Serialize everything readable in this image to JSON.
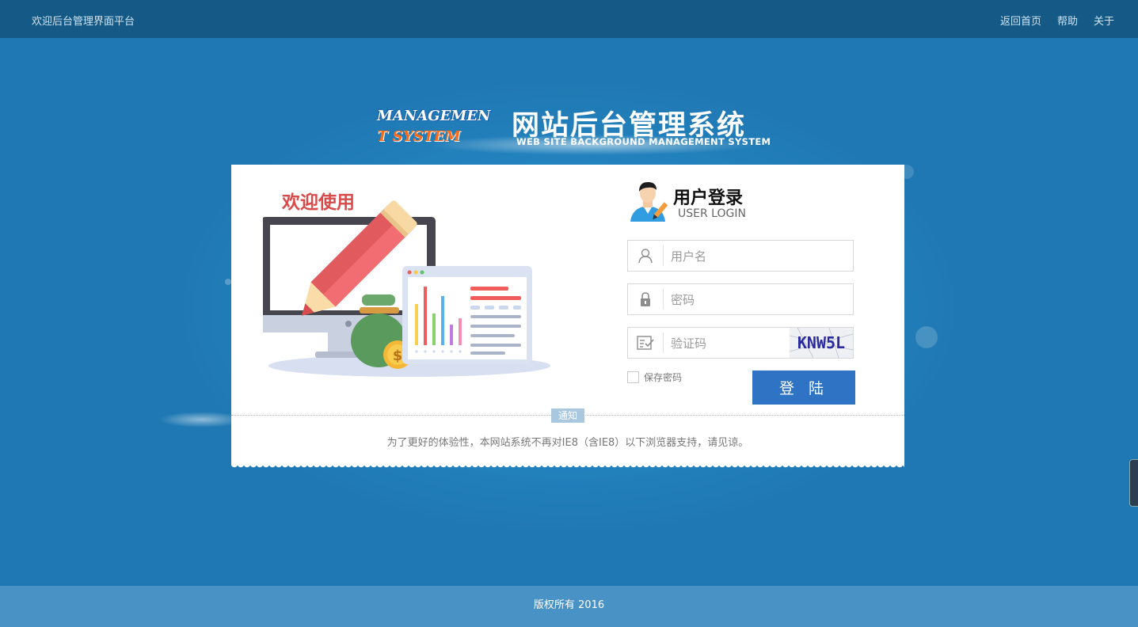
{
  "header": {
    "brand": "欢迎后台管理界面平台",
    "nav": [
      "返回首页",
      "帮助",
      "关于"
    ]
  },
  "logo": {
    "en_line1": "MANAGEMEN",
    "en_line2": "T SYSTEM",
    "cn_title": "网站后台管理系统",
    "subtitle": "WEB SITE BACKGROUND MANAGEMENT SYSTEM"
  },
  "illustration": {
    "welcome": "欢迎使用"
  },
  "login": {
    "title": "用户登录",
    "subtitle": "USER LOGIN",
    "username_placeholder": "用户名",
    "password_placeholder": "密码",
    "captcha_placeholder": "验证码",
    "captcha_text": "KNW5L",
    "remember_label": "保存密码",
    "submit_label": "登 陆"
  },
  "notice": {
    "tag": "通知",
    "text": "为了更好的体验性，本网站系统不再对IE8（含IE8）以下浏览器支持，请见谅。"
  },
  "footer": {
    "copyright": "版权所有 2016"
  },
  "colors": {
    "topbar": "#155a86",
    "background": "#1f78b3",
    "button": "#2e73c4",
    "footer": "#4992c5",
    "welcome": "#d94a4a"
  },
  "icons": [
    "user-icon",
    "lock-icon",
    "captcha-check-icon",
    "user-avatar-icon"
  ]
}
